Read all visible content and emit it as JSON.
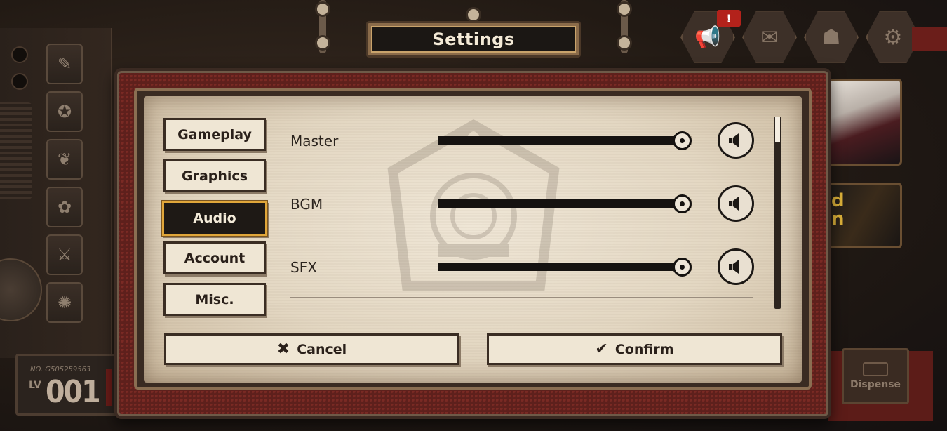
{
  "window": {
    "title": "Settings"
  },
  "player": {
    "id_label": "NO. G505259563",
    "level_label": "LV",
    "level_value": "001"
  },
  "top_right": {
    "notification_badge": "!"
  },
  "side": {
    "dispense_label": "Dispense"
  },
  "tabs": [
    {
      "label": "Gameplay",
      "active": false
    },
    {
      "label": "Graphics",
      "active": false
    },
    {
      "label": "Audio",
      "active": true
    },
    {
      "label": "Account",
      "active": false
    },
    {
      "label": "Misc.",
      "active": false
    }
  ],
  "audio": {
    "rows": [
      {
        "label": "Master",
        "level": 0.96,
        "icon": "speaker-icon"
      },
      {
        "label": "BGM",
        "level": 0.96,
        "icon": "speaker-icon"
      },
      {
        "label": "SFX",
        "level": 0.96,
        "icon": "speaker-icon"
      }
    ]
  },
  "actions": {
    "cancel_label": "Cancel",
    "confirm_label": "Confirm",
    "cancel_icon": "x-icon",
    "confirm_icon": "checkmark-icon"
  },
  "colors": {
    "accent": "#e0a63a",
    "dialog_red": "#5e201c",
    "paper": "#e6dac6",
    "ink": "#151210"
  }
}
